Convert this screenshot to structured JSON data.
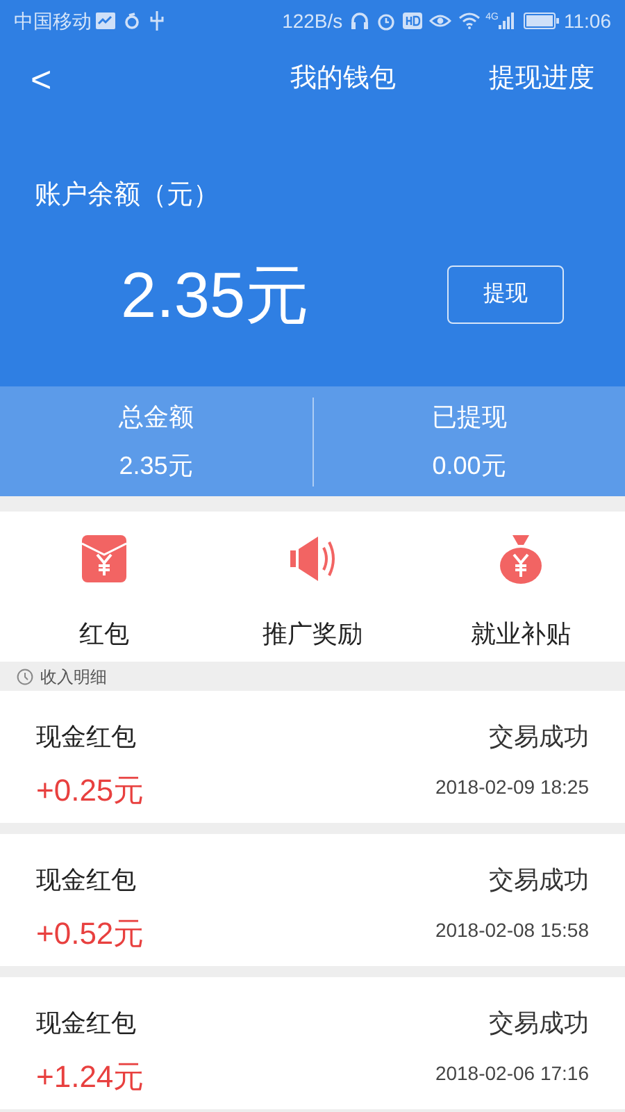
{
  "status_bar": {
    "carrier": "中国移动",
    "speed": "122B/s",
    "network": "4G",
    "time": "11:06"
  },
  "header": {
    "back": "<",
    "title": "我的钱包",
    "action": "提现进度"
  },
  "balance": {
    "label": "账户余额（元）",
    "amount": "2.35元",
    "button": "提现"
  },
  "stats": [
    {
      "label": "总金额",
      "value": "2.35元"
    },
    {
      "label": "已提现",
      "value": "0.00元"
    }
  ],
  "shortcuts": [
    {
      "kind": "envelope",
      "label": "红包"
    },
    {
      "kind": "speaker",
      "label": "推广奖励"
    },
    {
      "kind": "moneybag",
      "label": "就业补贴"
    }
  ],
  "section": {
    "title": "收入明细"
  },
  "records": [
    {
      "title": "现金红包",
      "amount": "+0.25元",
      "status": "交易成功",
      "time": "2018-02-09 18:25"
    },
    {
      "title": "现金红包",
      "amount": "+0.52元",
      "status": "交易成功",
      "time": "2018-02-08 15:58"
    },
    {
      "title": "现金红包",
      "amount": "+1.24元",
      "status": "交易成功",
      "time": "2018-02-06 17:16"
    }
  ]
}
